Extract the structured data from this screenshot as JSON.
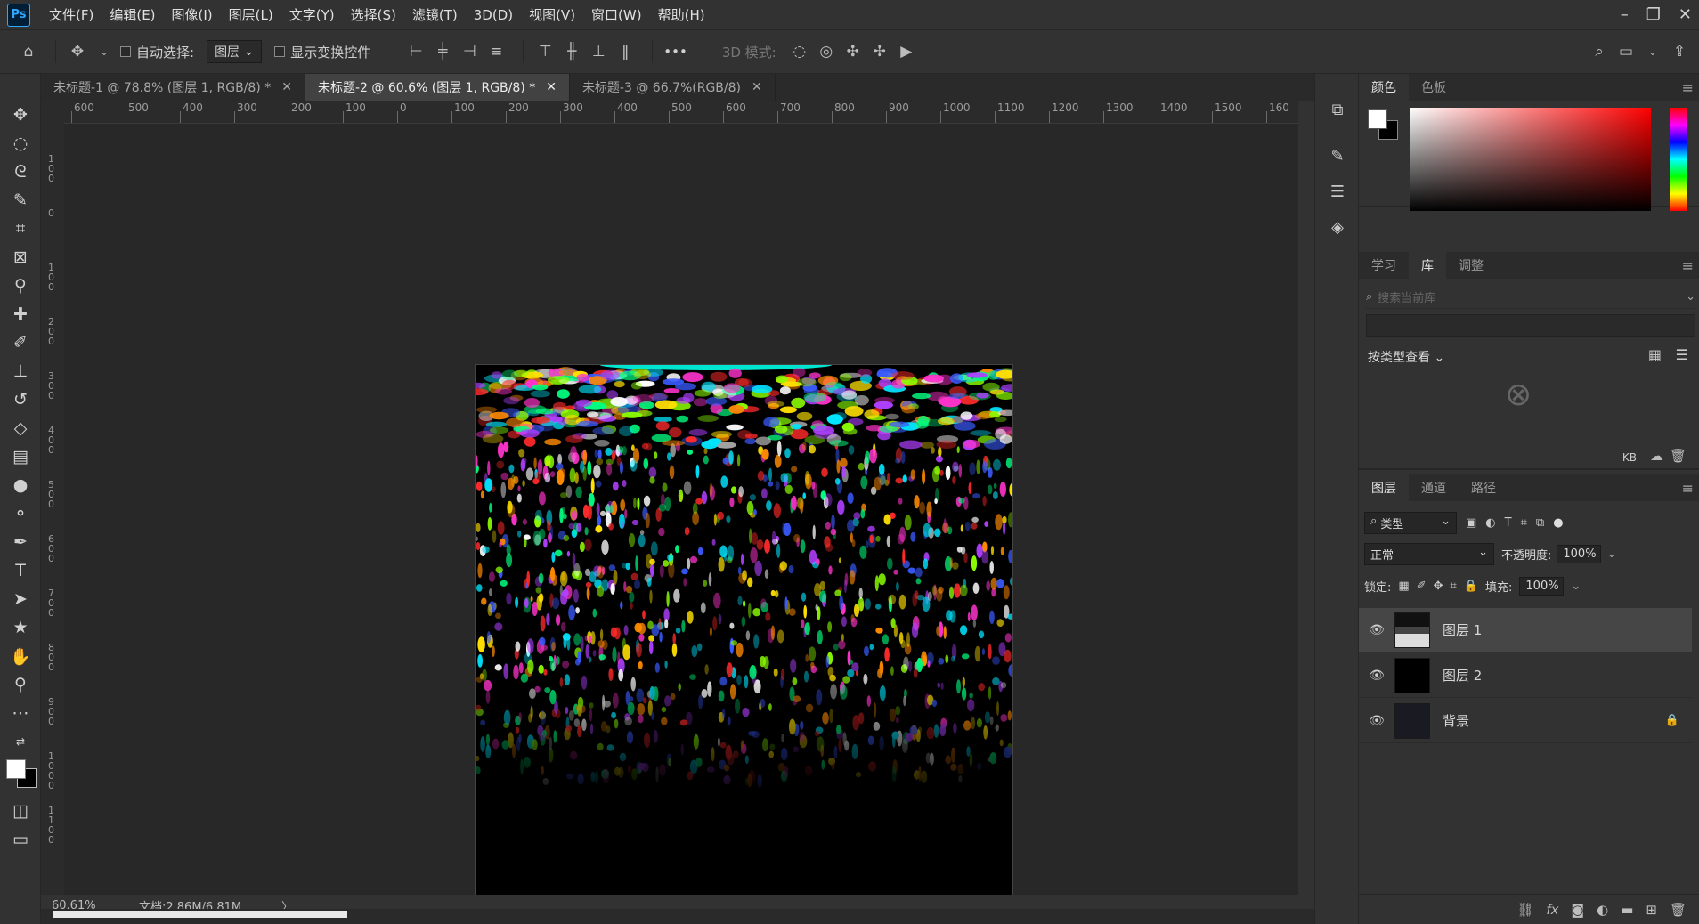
{
  "app": {
    "logo": "Ps"
  },
  "menu": [
    "文件(F)",
    "编辑(E)",
    "图像(I)",
    "图层(L)",
    "文字(Y)",
    "选择(S)",
    "滤镜(T)",
    "3D(D)",
    "视图(V)",
    "窗口(W)",
    "帮助(H)"
  ],
  "window_controls": {
    "minimize": "–",
    "restore": "❐",
    "close": "✕"
  },
  "options": {
    "auto_select_label": "自动选择:",
    "auto_select_value": "图层",
    "show_transform_label": "显示变换控件",
    "more": "•••",
    "mode_3d_label": "3D 模式:"
  },
  "doc_tabs": [
    {
      "label": "未标题-1 @ 78.8% (图层 1, RGB/8) *",
      "close": "✕"
    },
    {
      "label": "未标题-2 @ 60.6% (图层 1, RGB/8) *",
      "close": "✕"
    },
    {
      "label": "未标题-3 @ 66.7%(RGB/8)",
      "close": "✕"
    }
  ],
  "ruler_h": [
    "600",
    "500",
    "400",
    "300",
    "200",
    "100",
    "0",
    "100",
    "200",
    "300",
    "400",
    "500",
    "600",
    "700",
    "800",
    "900",
    "1000",
    "1100",
    "1200",
    "1300",
    "1400",
    "1500",
    "160"
  ],
  "ruler_v": [
    "1\n0\n0",
    "0",
    "1\n0\n0",
    "2\n0\n0",
    "3\n0\n0",
    "4\n0\n0",
    "5\n0\n0",
    "6\n0\n0",
    "7\n0\n0",
    "8\n0\n0",
    "9\n0\n0",
    "1\n0\n0\n0",
    "1\n1\n0\n0"
  ],
  "status": {
    "zoom": "60.61%",
    "doc": "文档:2.86M/6.81M",
    "arrow": "〉"
  },
  "color_panel": {
    "tabs": [
      "颜色",
      "色板"
    ]
  },
  "library_panel": {
    "tabs": [
      "学习",
      "库",
      "调整"
    ],
    "search_placeholder": "搜索当前库",
    "view_by": "按类型查看 ⌄",
    "size": "-- KB"
  },
  "layers_panel": {
    "tabs": [
      "图层",
      "通道",
      "路径"
    ],
    "filter_label": "类型",
    "blend_mode": "正常",
    "opacity_label": "不透明度:",
    "opacity_value": "100%",
    "lock_label": "锁定:",
    "fill_label": "填充:",
    "fill_value": "100%",
    "layers": [
      {
        "name": "图层 1"
      },
      {
        "name": "图层 2"
      },
      {
        "name": "背景"
      }
    ],
    "footer_icons": [
      "link-icon",
      "fx-icon",
      "mask-icon",
      "adjustment-icon",
      "folder-icon",
      "new-layer-icon",
      "trash-icon"
    ]
  }
}
